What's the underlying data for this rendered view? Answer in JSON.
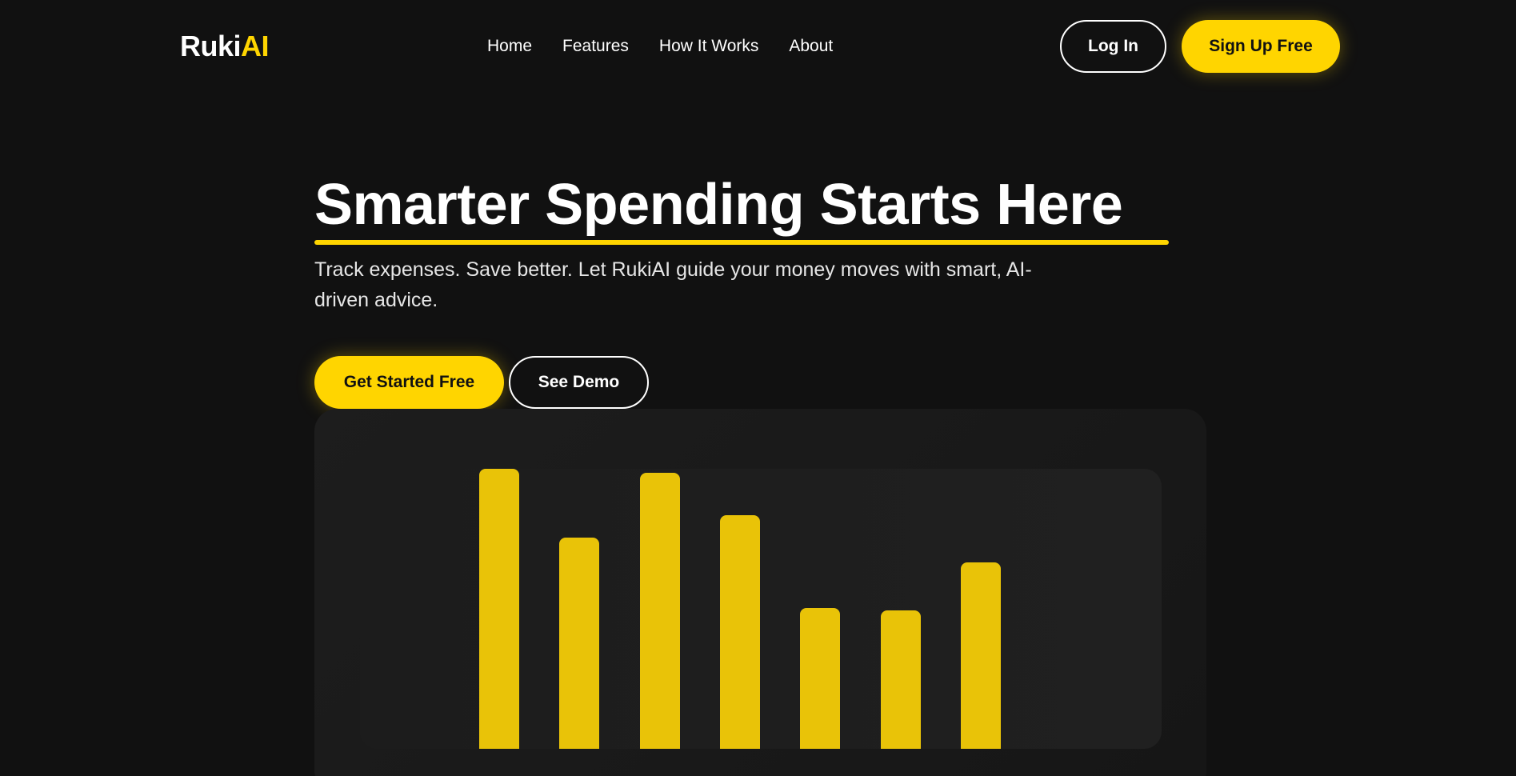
{
  "nav": {
    "logo_main": "Ruki",
    "logo_accent": "AI",
    "links": [
      "Home",
      "Features",
      "How It Works",
      "About"
    ],
    "login_label": "Log In",
    "signup_label": "Sign Up Free"
  },
  "hero": {
    "title": "Smarter Spending Starts Here",
    "subtitle": "Track expenses. Save better. Let RukiAI guide your money moves with smart, AI-driven advice.",
    "primary_cta": "Get Started Free",
    "secondary_cta": "See Demo"
  },
  "colors": {
    "background": "#111111",
    "accent": "#FFD500",
    "bar": "#E9C308"
  },
  "chart_data": {
    "type": "bar",
    "values": [
      100,
      75.5,
      98.6,
      83.4,
      50.3,
      49.3,
      66.6
    ],
    "ylim": [
      0,
      100
    ]
  }
}
